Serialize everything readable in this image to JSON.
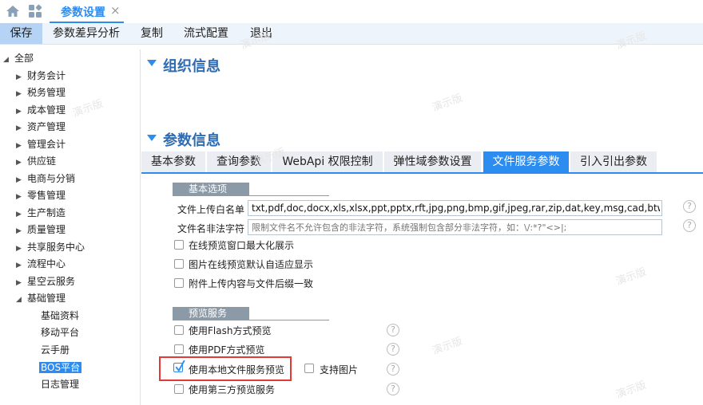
{
  "topbar": {
    "active_tab": "参数设置",
    "close": "×"
  },
  "toolbar": [
    "保存",
    "参数差异分析",
    "复制",
    "流式配置",
    "退出"
  ],
  "tree": {
    "root": "全部",
    "items": [
      "财务会计",
      "税务管理",
      "成本管理",
      "资产管理",
      "管理会计",
      "供应链",
      "电商与分销",
      "零售管理",
      "生产制造",
      "质量管理",
      "共享服务中心",
      "流程中心",
      "星空云服务",
      "基础管理"
    ],
    "children": [
      "基础资料",
      "移动平台",
      "云手册",
      "BOS平台",
      "日志管理"
    ]
  },
  "sections": {
    "org": "组织信息",
    "param": "参数信息"
  },
  "tabs": [
    "基本参数",
    "查询参数",
    "WebApi 权限控制",
    "弹性域参数设置",
    "文件服务参数",
    "引入引出参数"
  ],
  "basic": {
    "header": "基本选项",
    "whitelist_label": "文件上传白名单",
    "whitelist_value": "txt,pdf,doc,docx,xls,xlsx,ppt,pptx,rft,jpg,png,bmp,gif,jpeg,rar,zip,dat,key,msg,cad,btw,avi,rmvb",
    "illegal_label": "文件名非法字符",
    "illegal_placeholder": "限制文件名不允许包含的非法字符，系统强制包含部分非法字符，如：\\/:*?\"<>|;",
    "opt1": "在线预览窗口最大化展示",
    "opt2": "图片在线预览默认自适应显示",
    "opt3": "附件上传内容与文件后缀一致"
  },
  "preview": {
    "header": "预览服务",
    "flash": "使用Flash方式预览",
    "pdf": "使用PDF方式预览",
    "local": "使用本地文件服务预览",
    "support_image": "支持图片",
    "third": "使用第三方预览服务"
  },
  "watermark": "演示版",
  "help": "?"
}
